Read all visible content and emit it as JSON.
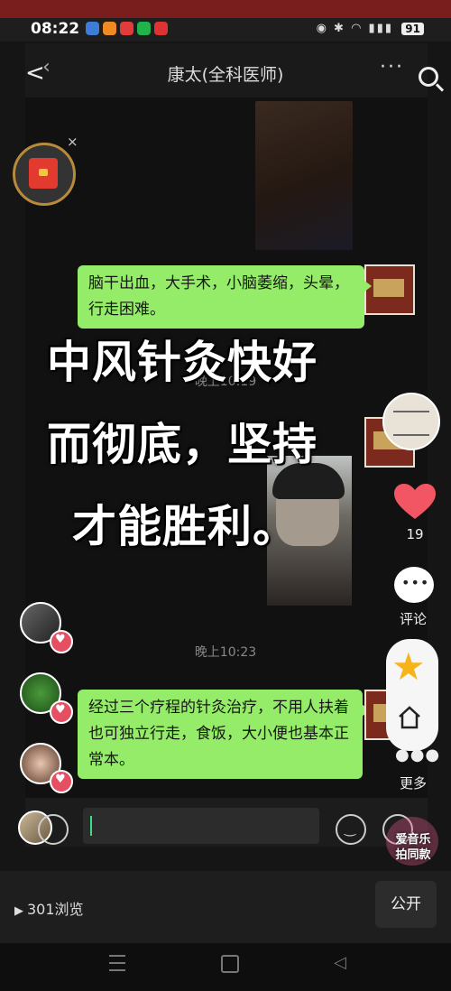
{
  "status_bar": {
    "time": "08:22",
    "battery": "91"
  },
  "chat": {
    "title": "康太(全科医师)",
    "messages": [
      {
        "text": "脑干出血，大手术，小脑萎缩，头晕，行走困难。"
      },
      {
        "timestamp": "晚上10:19"
      },
      {
        "timestamp": "晚上10:23"
      },
      {
        "text": "经过三个疗程的针灸治疗，不用人扶着也可独立行走，食饭，大小便也基本正常本。"
      }
    ]
  },
  "overlay_caption": {
    "line1": "中风针灸快好",
    "line2": "而彻底，坚持",
    "line3": "才能胜利。"
  },
  "side_actions": {
    "like_count": "19",
    "comment_label": "评论",
    "more_label": "更多"
  },
  "music_badge": {
    "line1": "爱音乐",
    "line2": "拍同款"
  },
  "bottom": {
    "views": "301浏览",
    "public_button": "公开"
  },
  "icons": {
    "heart_color": "#f25563",
    "star_color": "#f6b41a",
    "bubble_color": "#95ec69"
  }
}
